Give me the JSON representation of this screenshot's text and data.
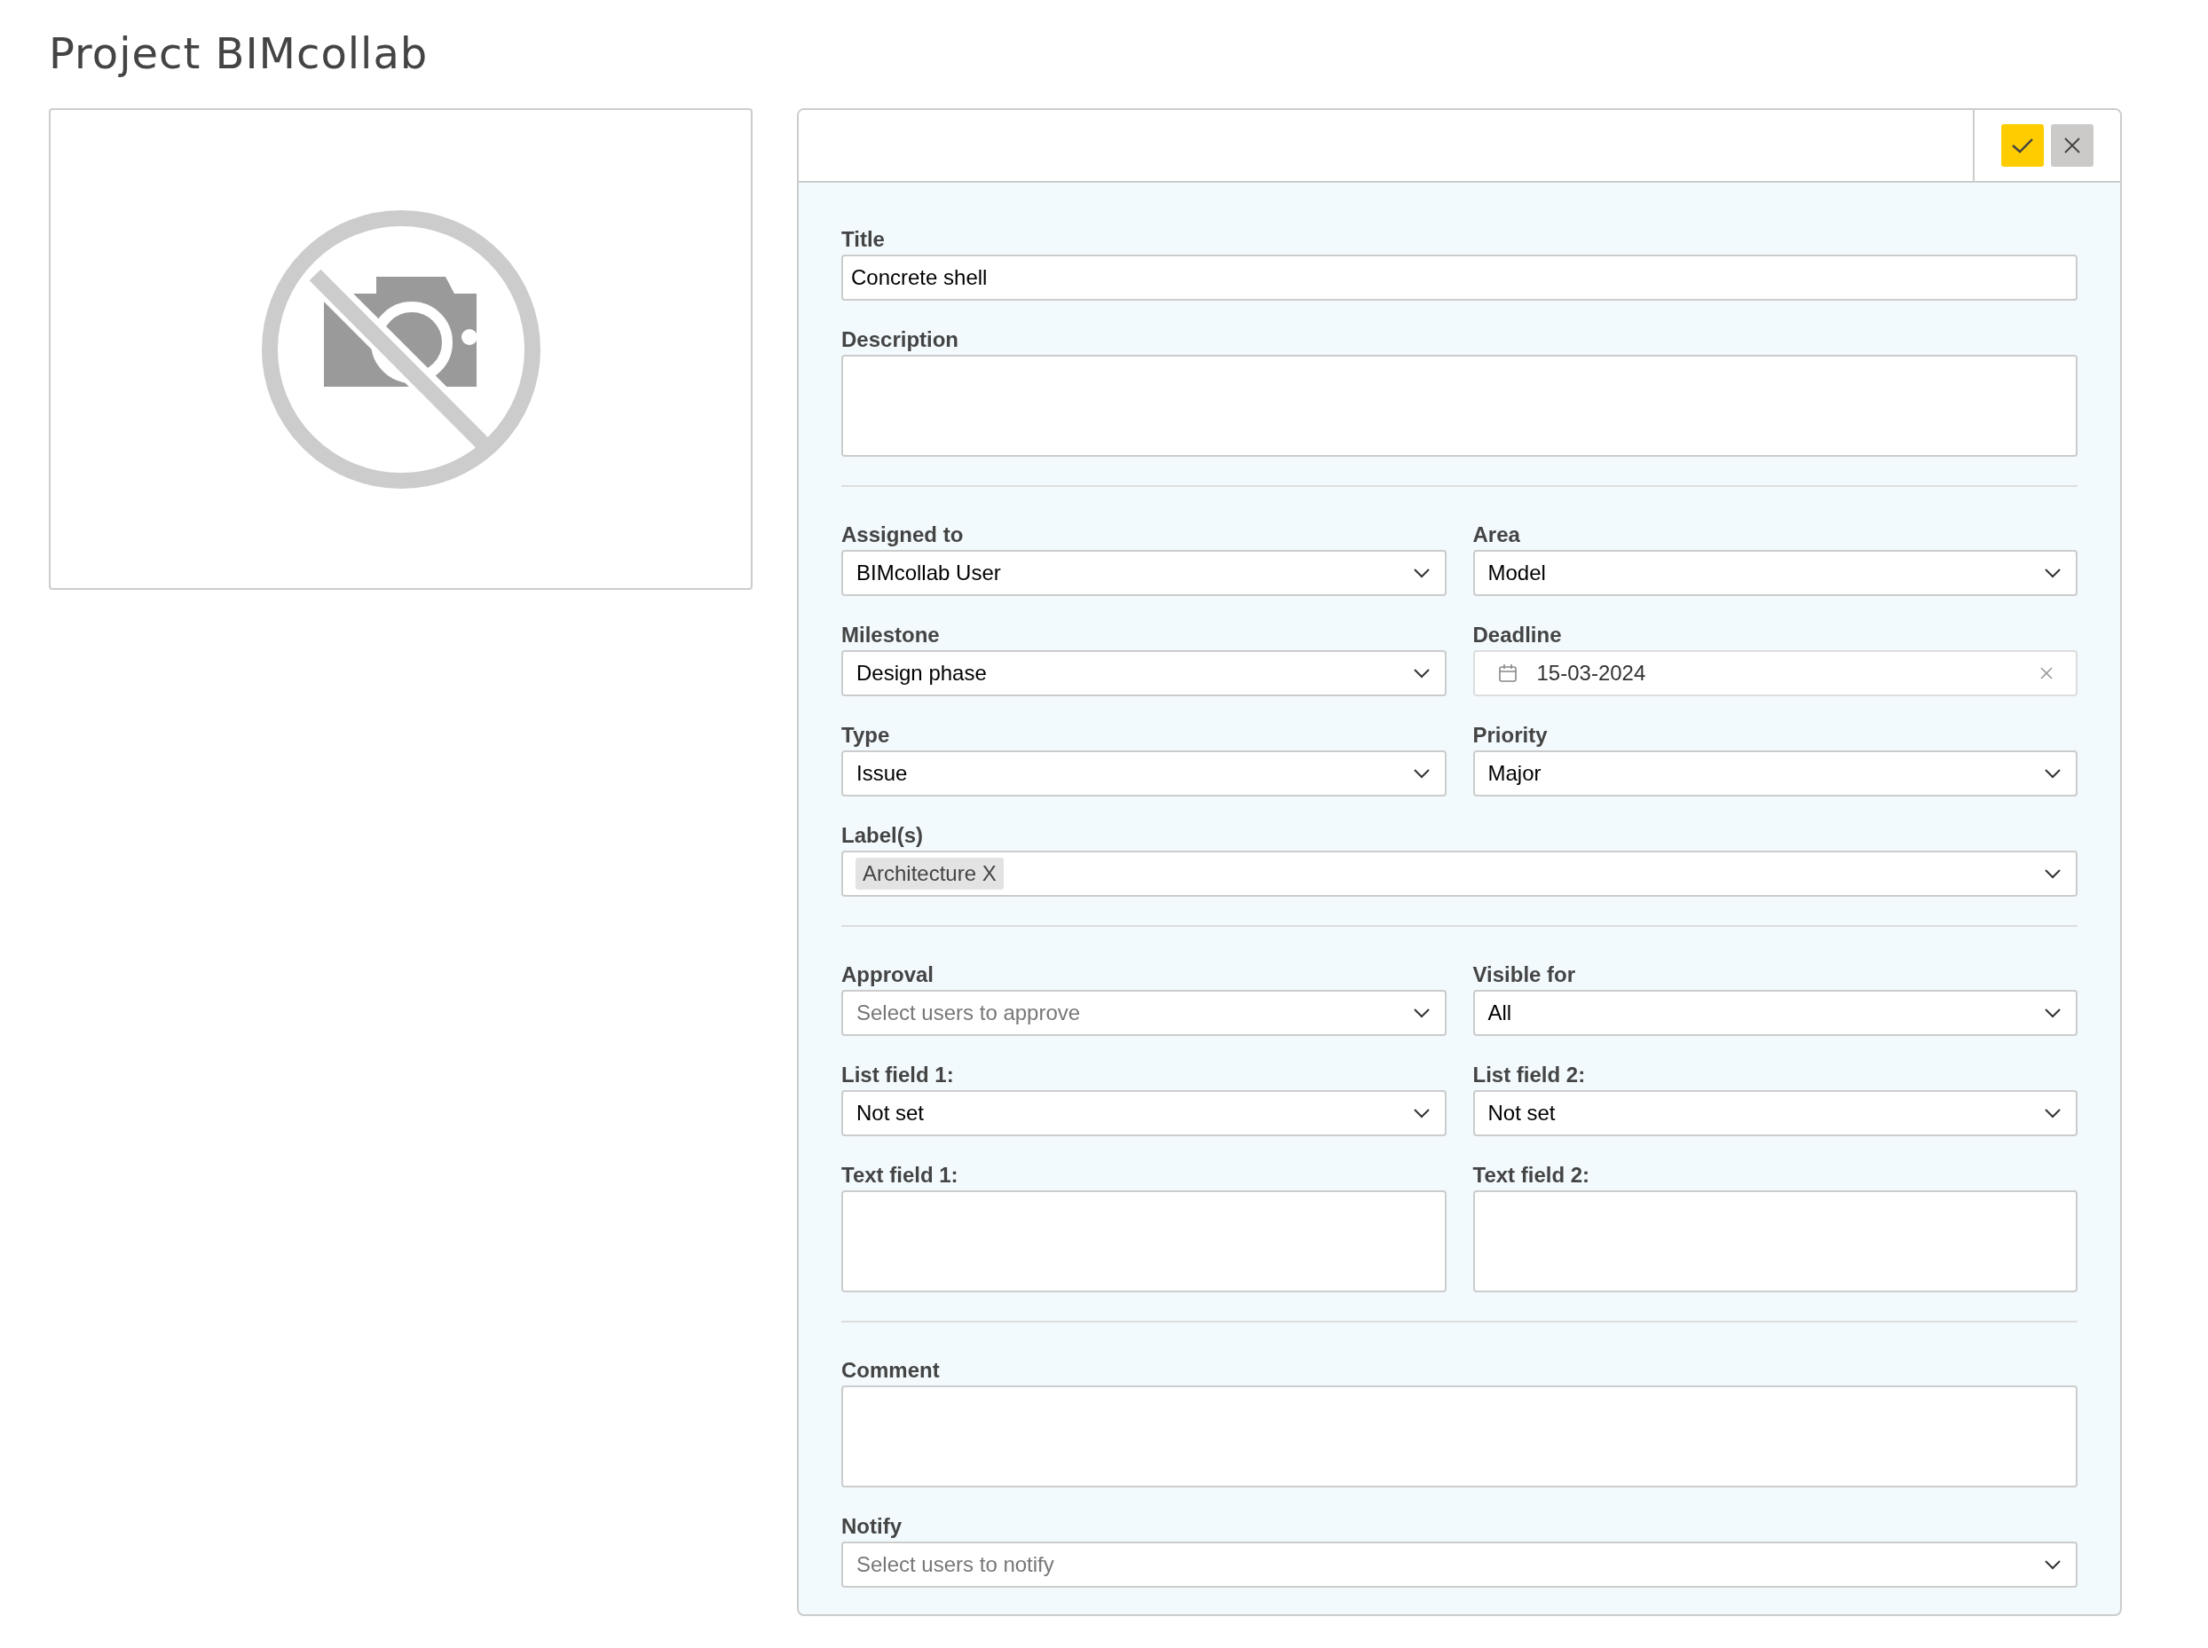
{
  "page_title": "Project BIMcollab",
  "sections": [
    {
      "rows": [
        [
          {
            "kind": "text",
            "label": "Title",
            "value": "Concrete shell"
          }
        ],
        [
          {
            "kind": "textarea",
            "label": "Description"
          }
        ]
      ]
    },
    {
      "rows": [
        [
          {
            "kind": "select",
            "label": "Assigned to",
            "value": "BIMcollab User"
          },
          {
            "kind": "select",
            "label": "Area",
            "value": "Model"
          }
        ],
        [
          {
            "kind": "select",
            "label": "Milestone",
            "value": "Design phase"
          },
          {
            "kind": "date",
            "label": "Deadline",
            "value": "15-03-2024"
          }
        ],
        [
          {
            "kind": "select",
            "label": "Type",
            "value": "Issue"
          },
          {
            "kind": "select",
            "label": "Priority",
            "value": "Major"
          }
        ],
        [
          {
            "kind": "tags",
            "label": "Label(s)",
            "tags": [
              "Architecture X"
            ]
          }
        ]
      ]
    },
    {
      "rows": [
        [
          {
            "kind": "select",
            "label": "Approval",
            "placeholder": "Select users to approve"
          },
          {
            "kind": "select",
            "label": "Visible for",
            "value": "All"
          }
        ],
        [
          {
            "kind": "select",
            "label": "List field 1:",
            "value": "Not set"
          },
          {
            "kind": "select",
            "label": "List field 2:",
            "value": "Not set"
          }
        ],
        [
          {
            "kind": "textarea",
            "label": "Text field 1:"
          },
          {
            "kind": "textarea",
            "label": "Text field 2:"
          }
        ]
      ]
    },
    {
      "rows": [
        [
          {
            "kind": "textarea",
            "label": "Comment"
          }
        ],
        [
          {
            "kind": "select",
            "label": "Notify",
            "placeholder": "Select users to notify"
          }
        ]
      ]
    }
  ]
}
